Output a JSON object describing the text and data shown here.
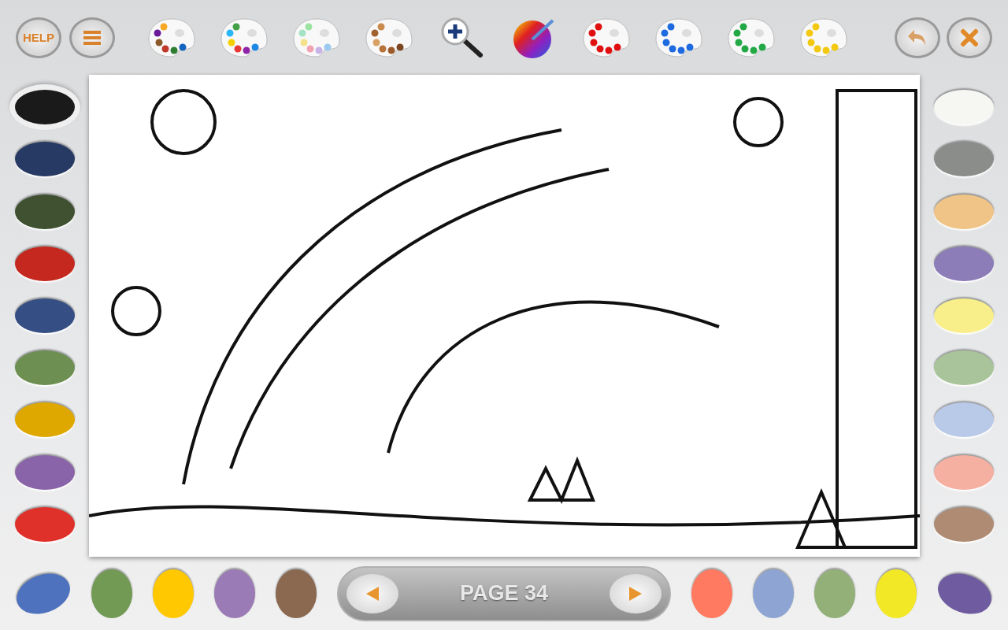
{
  "toolbar": {
    "help": "HELP",
    "palettes": [
      {
        "kind": "multi",
        "dots": [
          {
            "color": "#8b5a2b"
          },
          {
            "color": "#c0392b"
          },
          {
            "color": "#2e7d32"
          },
          {
            "color": "#1565c0"
          },
          {
            "color": "#6a1b9a"
          },
          {
            "color": "#f9a825"
          }
        ]
      },
      {
        "kind": "multi",
        "dots": [
          {
            "color": "#f5d000"
          },
          {
            "color": "#e53935"
          },
          {
            "color": "#8e24aa"
          },
          {
            "color": "#1e88e5"
          },
          {
            "color": "#29b6f6"
          },
          {
            "color": "#43a047"
          }
        ]
      },
      {
        "kind": "multi",
        "dots": [
          {
            "color": "#f4e28a"
          },
          {
            "color": "#f2a3b3"
          },
          {
            "color": "#c7b3e6"
          },
          {
            "color": "#9cc9f0"
          },
          {
            "color": "#a6e3c4"
          },
          {
            "color": "#9be3a0"
          }
        ]
      },
      {
        "kind": "multi",
        "dots": [
          {
            "color": "#d9a066"
          },
          {
            "color": "#b8733a"
          },
          {
            "color": "#9c5a2a"
          },
          {
            "color": "#7a4520"
          },
          {
            "color": "#a0622e"
          },
          {
            "color": "#c98a4b"
          }
        ]
      },
      {
        "kind": "zoom"
      },
      {
        "kind": "wheel"
      },
      {
        "kind": "multi",
        "dots": [
          {
            "color": "#e01010"
          },
          {
            "color": "#e01010"
          },
          {
            "color": "#e01010"
          },
          {
            "color": "#e01010"
          },
          {
            "color": "#e01010"
          },
          {
            "color": "#e01010"
          }
        ]
      },
      {
        "kind": "multi",
        "dots": [
          {
            "color": "#1e6ae0"
          },
          {
            "color": "#1e6ae0"
          },
          {
            "color": "#1e6ae0"
          },
          {
            "color": "#1e6ae0"
          },
          {
            "color": "#1e6ae0"
          },
          {
            "color": "#1e6ae0"
          }
        ]
      },
      {
        "kind": "multi",
        "dots": [
          {
            "color": "#22a845"
          },
          {
            "color": "#22a845"
          },
          {
            "color": "#22a845"
          },
          {
            "color": "#22a845"
          },
          {
            "color": "#22a845"
          },
          {
            "color": "#22a845"
          }
        ]
      },
      {
        "kind": "multi",
        "dots": [
          {
            "color": "#f2c810"
          },
          {
            "color": "#f2c810"
          },
          {
            "color": "#f2c810"
          },
          {
            "color": "#f2c810"
          },
          {
            "color": "#f2c810"
          },
          {
            "color": "#f2c810"
          }
        ]
      }
    ]
  },
  "left_swatches": [
    {
      "color": "#1a1a1a",
      "selected": true
    },
    {
      "color": "#263a63",
      "selected": false
    },
    {
      "color": "#3f5130",
      "selected": false
    },
    {
      "color": "#c4281e",
      "selected": false
    },
    {
      "color": "#354f85",
      "selected": false
    },
    {
      "color": "#6e8f52",
      "selected": false
    },
    {
      "color": "#dea800",
      "selected": false
    },
    {
      "color": "#8a64a8",
      "selected": false
    },
    {
      "color": "#e0302a",
      "selected": false
    }
  ],
  "right_swatches": [
    {
      "color": "#f6f6f2",
      "selected": false
    },
    {
      "color": "#8b8d8b",
      "selected": false
    },
    {
      "color": "#f0c487",
      "selected": false
    },
    {
      "color": "#8c7cb8",
      "selected": false
    },
    {
      "color": "#f8ef8a",
      "selected": false
    },
    {
      "color": "#a9c49a",
      "selected": false
    },
    {
      "color": "#b9c9e8",
      "selected": false
    },
    {
      "color": "#f6b0a2",
      "selected": false
    },
    {
      "color": "#ae8b72",
      "selected": false
    }
  ],
  "bottom_left_swatches": [
    {
      "color": "#4e72bd",
      "selected": false
    },
    {
      "color": "#729a55",
      "selected": false
    },
    {
      "color": "#ffc800",
      "selected": false
    },
    {
      "color": "#9b7bb5",
      "selected": false
    },
    {
      "color": "#8b6850",
      "selected": false
    }
  ],
  "pager": {
    "label": "PAGE 34"
  },
  "bottom_right_swatches": [
    {
      "color": "#ff7a60",
      "selected": false
    },
    {
      "color": "#8ea5d3",
      "selected": false
    },
    {
      "color": "#92b078",
      "selected": false
    },
    {
      "color": "#f3e826",
      "selected": false
    },
    {
      "color": "#6f5ba0",
      "selected": false
    }
  ]
}
